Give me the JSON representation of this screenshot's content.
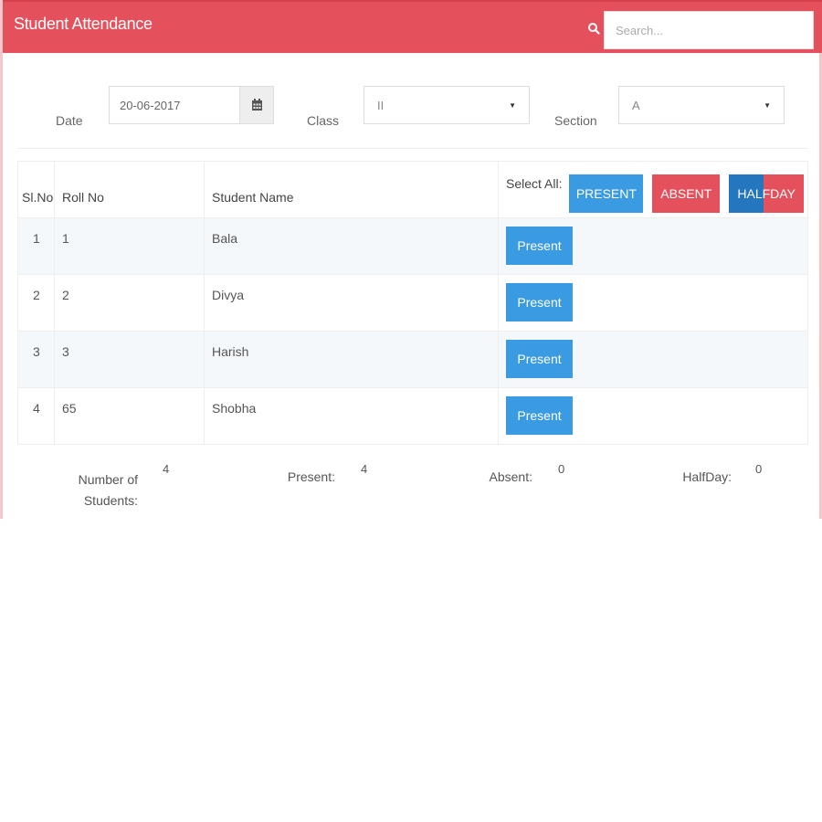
{
  "header": {
    "title": "Student Attendance",
    "search_placeholder": "Search..."
  },
  "filters": {
    "date_label": "Date",
    "date_value": "20-06-2017",
    "class_label": "Class",
    "class_value": "II",
    "section_label": "Section",
    "section_value": "A"
  },
  "table": {
    "headers": {
      "sl": "Sl.No",
      "roll": "Roll No",
      "name": "Student Name",
      "select_all": "Select All:"
    },
    "select_all_buttons": {
      "present": "PRESENT",
      "absent": "ABSENT",
      "halfday": "HALFDAY"
    },
    "rows": [
      {
        "sl": "1",
        "roll": "1",
        "name": "Bala",
        "status": "Present"
      },
      {
        "sl": "2",
        "roll": "2",
        "name": "Divya",
        "status": "Present"
      },
      {
        "sl": "3",
        "roll": "3",
        "name": "Harish",
        "status": "Present"
      },
      {
        "sl": "4",
        "roll": "65",
        "name": "Shobha",
        "status": "Present"
      }
    ]
  },
  "summary": {
    "students_label": "Number of Students:",
    "students_value": "4",
    "present_label": "Present:",
    "present_value": "4",
    "absent_label": "Absent:",
    "absent_value": "0",
    "halfday_label": "HalfDay:",
    "halfday_value": "0"
  },
  "colors": {
    "header": "#e4505c",
    "present": "#3a9be2",
    "absent": "#e4505c",
    "halfday_left": "#2477bf"
  },
  "icons": {
    "search": "search-icon",
    "calendar": "calendar-icon",
    "dropdown": "chevron-down-icon"
  }
}
